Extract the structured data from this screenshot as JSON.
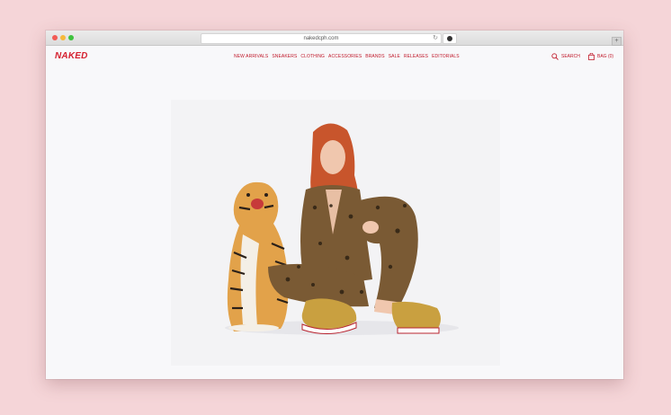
{
  "browser": {
    "url": "nakedcph.com",
    "new_tab": "+"
  },
  "site": {
    "logo": "NAKED",
    "nav": [
      "NEW ARRIVALS",
      "SNEAKERS",
      "CLOTHING",
      "ACCESSORIES",
      "BRANDS",
      "SALE",
      "RELEASES",
      "EDITORIALS"
    ],
    "search_label": "SEARCH",
    "bag_label": "BAG (0)"
  },
  "colors": {
    "brand": "#d51f2e",
    "background": "#f5d5d8"
  },
  "hero": {
    "image": "editorial-photo-woman-with-tiger-statue"
  }
}
